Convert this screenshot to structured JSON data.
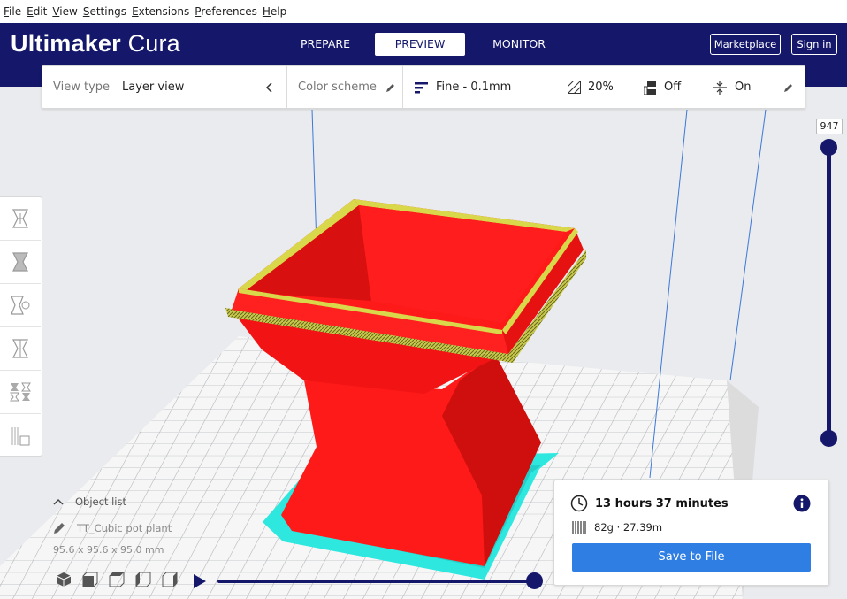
{
  "menubar": {
    "items": [
      {
        "mnemonic": "F",
        "rest": "ile"
      },
      {
        "mnemonic": "E",
        "rest": "dit"
      },
      {
        "mnemonic": "V",
        "rest": "iew"
      },
      {
        "mnemonic": "S",
        "rest": "ettings"
      },
      {
        "mnemonic": "E",
        "rest": "xtensions"
      },
      {
        "mnemonic": "P",
        "rest": "references"
      },
      {
        "mnemonic": "H",
        "rest": "elp"
      }
    ]
  },
  "header": {
    "logo_bold": "Ultimaker",
    "logo_light": "Cura",
    "tabs": [
      {
        "label": "PREPARE",
        "active": false
      },
      {
        "label": "PREVIEW",
        "active": true
      },
      {
        "label": "MONITOR",
        "active": false
      }
    ],
    "marketplace_label": "Marketplace",
    "signin_label": "Sign in",
    "bg_color": "#15186a"
  },
  "settings_bar": {
    "view_type_label": "View type",
    "view_type_value": "Layer view",
    "color_scheme_label": "Color scheme",
    "profile": "Fine - 0.1mm",
    "infill": "20%",
    "support": "Off",
    "adhesion": "On"
  },
  "layer_slider": {
    "current_layer": "947"
  },
  "object_list": {
    "header": "Object list",
    "object_name": "TT_Cubic pot plant",
    "dimensions": "95.6 x 95.6 x 95.0 mm"
  },
  "print_info": {
    "time": "13 hours 37 minutes",
    "material": "82g · 27.39m",
    "save_label": "Save to File",
    "accent_color": "#2f7ee4"
  },
  "model_colors": {
    "wall": "#ff1a1a",
    "shell_edge": "#d8d84a",
    "skirt": "#2ee8e0"
  },
  "icons": {
    "view_type": "chevron-left-icon",
    "color_scheme": "pencil-icon",
    "profile": "profile-bars-icon",
    "infill": "infill-icon",
    "support": "support-icon",
    "adhesion": "adhesion-icon",
    "settings_edit": "pencil-icon",
    "time": "clock-icon",
    "info": "info-icon",
    "material": "spool-icon"
  }
}
